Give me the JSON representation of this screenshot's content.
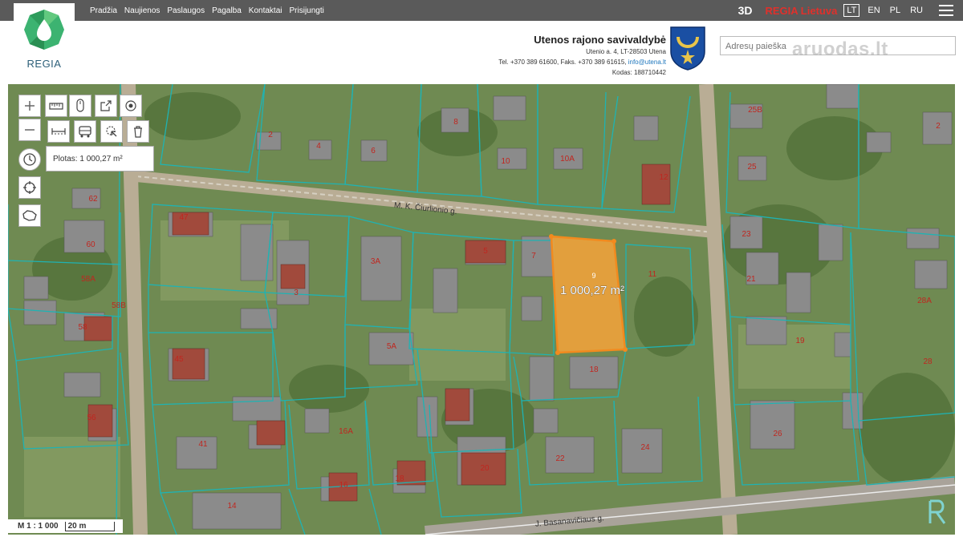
{
  "nav": {
    "items": [
      "Pradžia",
      "Naujienos",
      "Paslaugos",
      "Pagalba",
      "Kontaktai",
      "Prisijungti"
    ],
    "mode_3d": "3D",
    "regia_country": "REGIA Lietuva",
    "languages": [
      "LT",
      "EN",
      "PL",
      "RU"
    ],
    "active_language": "LT"
  },
  "logo": {
    "text": "REGIA"
  },
  "municipality": {
    "title": "Utenos rajono savivaldybė",
    "address": "Utenio a. 4, LT-28503 Utena",
    "phone_prefix": "Tel. +370 389 61600, Faks. +370 389 61615, ",
    "email": "info@utena.lt",
    "code": "Kodas: 188710442"
  },
  "search": {
    "placeholder": "Adresų paieška"
  },
  "watermark": "aruodas.lt",
  "map_tools": {
    "area_label": "Plotas: 1 000,27 m²",
    "icons": [
      "zoom-in-icon",
      "zoom-out-icon",
      "ruler-icon",
      "mouse-icon",
      "export-icon",
      "target-icon",
      "measure-line-icon",
      "bus-icon",
      "select-icon",
      "trash-icon",
      "history-icon",
      "crosshair-icon",
      "region-icon"
    ]
  },
  "map_labels": {
    "parcel_area": "1 000,27 m²",
    "parcel_number": "9",
    "street_1": "M. K. Čiurlionio g.",
    "street_2": "J. Basanavičiaus g.",
    "house_numbers": [
      "2",
      "4",
      "6",
      "8",
      "10",
      "10A",
      "12",
      "2",
      "25B",
      "25",
      "47",
      "62",
      "60",
      "58A",
      "58B",
      "58",
      "3A",
      "3",
      "5",
      "7",
      "11",
      "5A",
      "45",
      "56",
      "41",
      "14",
      "16A",
      "16",
      "18",
      "20",
      "22",
      "18",
      "24",
      "23",
      "21",
      "19",
      "26",
      "28A",
      "28"
    ]
  },
  "scale": {
    "ratio": "M 1 : 1 000",
    "bar": "20 m"
  },
  "colors": {
    "topbar": "#5a5a5a",
    "parcel_fill": "#f7a23a",
    "parcel_stroke": "#f28a1e",
    "boundary": "#1fb3b3",
    "regia_red": "#e0302b",
    "link_blue": "#1b75bc"
  }
}
